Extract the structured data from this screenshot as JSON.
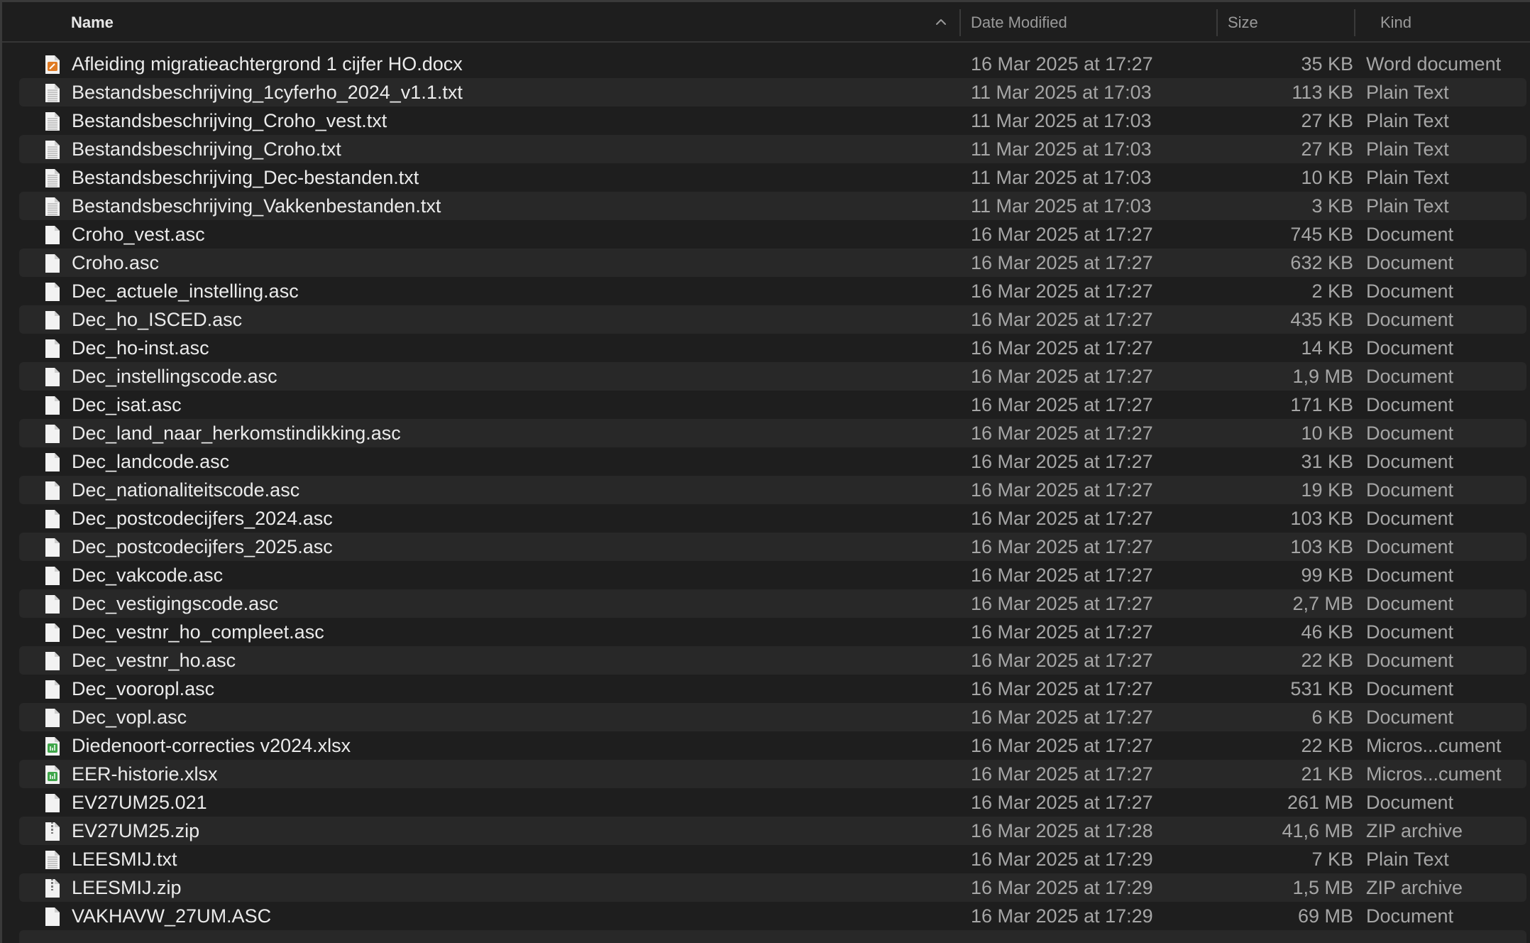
{
  "columns": {
    "name": "Name",
    "date": "Date Modified",
    "size": "Size",
    "kind": "Kind"
  },
  "colors": {
    "background": "#1e1e1e",
    "row_alt": "#282828",
    "text_primary": "#ebebeb",
    "text_secondary": "#a6a6a6",
    "word_icon": "#e07b24",
    "excel_icon": "#3fa64a"
  },
  "files": [
    {
      "name": "Afleiding migratieachtergrond 1 cijfer HO.docx",
      "date": "16 Mar 2025 at 17:27",
      "size": "35 KB",
      "kind": "Word document",
      "icon": "word-doc-icon"
    },
    {
      "name": "Bestandsbeschrijving_1cyferho_2024_v1.1.txt",
      "date": "11 Mar 2025 at 17:03",
      "size": "113 KB",
      "kind": "Plain Text",
      "icon": "text-file-icon"
    },
    {
      "name": "Bestandsbeschrijving_Croho_vest.txt",
      "date": "11 Mar 2025 at 17:03",
      "size": "27 KB",
      "kind": "Plain Text",
      "icon": "text-file-icon"
    },
    {
      "name": "Bestandsbeschrijving_Croho.txt",
      "date": "11 Mar 2025 at 17:03",
      "size": "27 KB",
      "kind": "Plain Text",
      "icon": "text-file-icon"
    },
    {
      "name": "Bestandsbeschrijving_Dec-bestanden.txt",
      "date": "11 Mar 2025 at 17:03",
      "size": "10 KB",
      "kind": "Plain Text",
      "icon": "text-file-icon"
    },
    {
      "name": "Bestandsbeschrijving_Vakkenbestanden.txt",
      "date": "11 Mar 2025 at 17:03",
      "size": "3 KB",
      "kind": "Plain Text",
      "icon": "text-file-icon"
    },
    {
      "name": "Croho_vest.asc",
      "date": "16 Mar 2025 at 17:27",
      "size": "745 KB",
      "kind": "Document",
      "icon": "document-icon"
    },
    {
      "name": "Croho.asc",
      "date": "16 Mar 2025 at 17:27",
      "size": "632 KB",
      "kind": "Document",
      "icon": "document-icon"
    },
    {
      "name": "Dec_actuele_instelling.asc",
      "date": "16 Mar 2025 at 17:27",
      "size": "2 KB",
      "kind": "Document",
      "icon": "document-icon"
    },
    {
      "name": "Dec_ho_ISCED.asc",
      "date": "16 Mar 2025 at 17:27",
      "size": "435 KB",
      "kind": "Document",
      "icon": "document-icon"
    },
    {
      "name": "Dec_ho-inst.asc",
      "date": "16 Mar 2025 at 17:27",
      "size": "14 KB",
      "kind": "Document",
      "icon": "document-icon"
    },
    {
      "name": "Dec_instellingscode.asc",
      "date": "16 Mar 2025 at 17:27",
      "size": "1,9 MB",
      "kind": "Document",
      "icon": "document-icon"
    },
    {
      "name": "Dec_isat.asc",
      "date": "16 Mar 2025 at 17:27",
      "size": "171 KB",
      "kind": "Document",
      "icon": "document-icon"
    },
    {
      "name": "Dec_land_naar_herkomstindikking.asc",
      "date": "16 Mar 2025 at 17:27",
      "size": "10 KB",
      "kind": "Document",
      "icon": "document-icon"
    },
    {
      "name": "Dec_landcode.asc",
      "date": "16 Mar 2025 at 17:27",
      "size": "31 KB",
      "kind": "Document",
      "icon": "document-icon"
    },
    {
      "name": "Dec_nationaliteitscode.asc",
      "date": "16 Mar 2025 at 17:27",
      "size": "19 KB",
      "kind": "Document",
      "icon": "document-icon"
    },
    {
      "name": "Dec_postcodecijfers_2024.asc",
      "date": "16 Mar 2025 at 17:27",
      "size": "103 KB",
      "kind": "Document",
      "icon": "document-icon"
    },
    {
      "name": "Dec_postcodecijfers_2025.asc",
      "date": "16 Mar 2025 at 17:27",
      "size": "103 KB",
      "kind": "Document",
      "icon": "document-icon"
    },
    {
      "name": "Dec_vakcode.asc",
      "date": "16 Mar 2025 at 17:27",
      "size": "99 KB",
      "kind": "Document",
      "icon": "document-icon"
    },
    {
      "name": "Dec_vestigingscode.asc",
      "date": "16 Mar 2025 at 17:27",
      "size": "2,7 MB",
      "kind": "Document",
      "icon": "document-icon"
    },
    {
      "name": "Dec_vestnr_ho_compleet.asc",
      "date": "16 Mar 2025 at 17:27",
      "size": "46 KB",
      "kind": "Document",
      "icon": "document-icon"
    },
    {
      "name": "Dec_vestnr_ho.asc",
      "date": "16 Mar 2025 at 17:27",
      "size": "22 KB",
      "kind": "Document",
      "icon": "document-icon"
    },
    {
      "name": "Dec_vooropl.asc",
      "date": "16 Mar 2025 at 17:27",
      "size": "531 KB",
      "kind": "Document",
      "icon": "document-icon"
    },
    {
      "name": "Dec_vopl.asc",
      "date": "16 Mar 2025 at 17:27",
      "size": "6 KB",
      "kind": "Document",
      "icon": "document-icon"
    },
    {
      "name": "Diedenoort-correcties v2024.xlsx",
      "date": "16 Mar 2025 at 17:27",
      "size": "22 KB",
      "kind": "Micros...cument",
      "icon": "excel-doc-icon"
    },
    {
      "name": "EER-historie.xlsx",
      "date": "16 Mar 2025 at 17:27",
      "size": "21 KB",
      "kind": "Micros...cument",
      "icon": "excel-doc-icon"
    },
    {
      "name": "EV27UM25.021",
      "date": "16 Mar 2025 at 17:27",
      "size": "261 MB",
      "kind": "Document",
      "icon": "document-icon"
    },
    {
      "name": "EV27UM25.zip",
      "date": "16 Mar 2025 at 17:28",
      "size": "41,6 MB",
      "kind": "ZIP archive",
      "icon": "zip-archive-icon"
    },
    {
      "name": "LEESMIJ.txt",
      "date": "16 Mar 2025 at 17:29",
      "size": "7 KB",
      "kind": "Plain Text",
      "icon": "text-file-icon"
    },
    {
      "name": "LEESMIJ.zip",
      "date": "16 Mar 2025 at 17:29",
      "size": "1,5 MB",
      "kind": "ZIP archive",
      "icon": "zip-archive-icon"
    },
    {
      "name": "VAKHAVW_27UM.ASC",
      "date": "16 Mar 2025 at 17:29",
      "size": "69 MB",
      "kind": "Document",
      "icon": "document-icon"
    }
  ]
}
